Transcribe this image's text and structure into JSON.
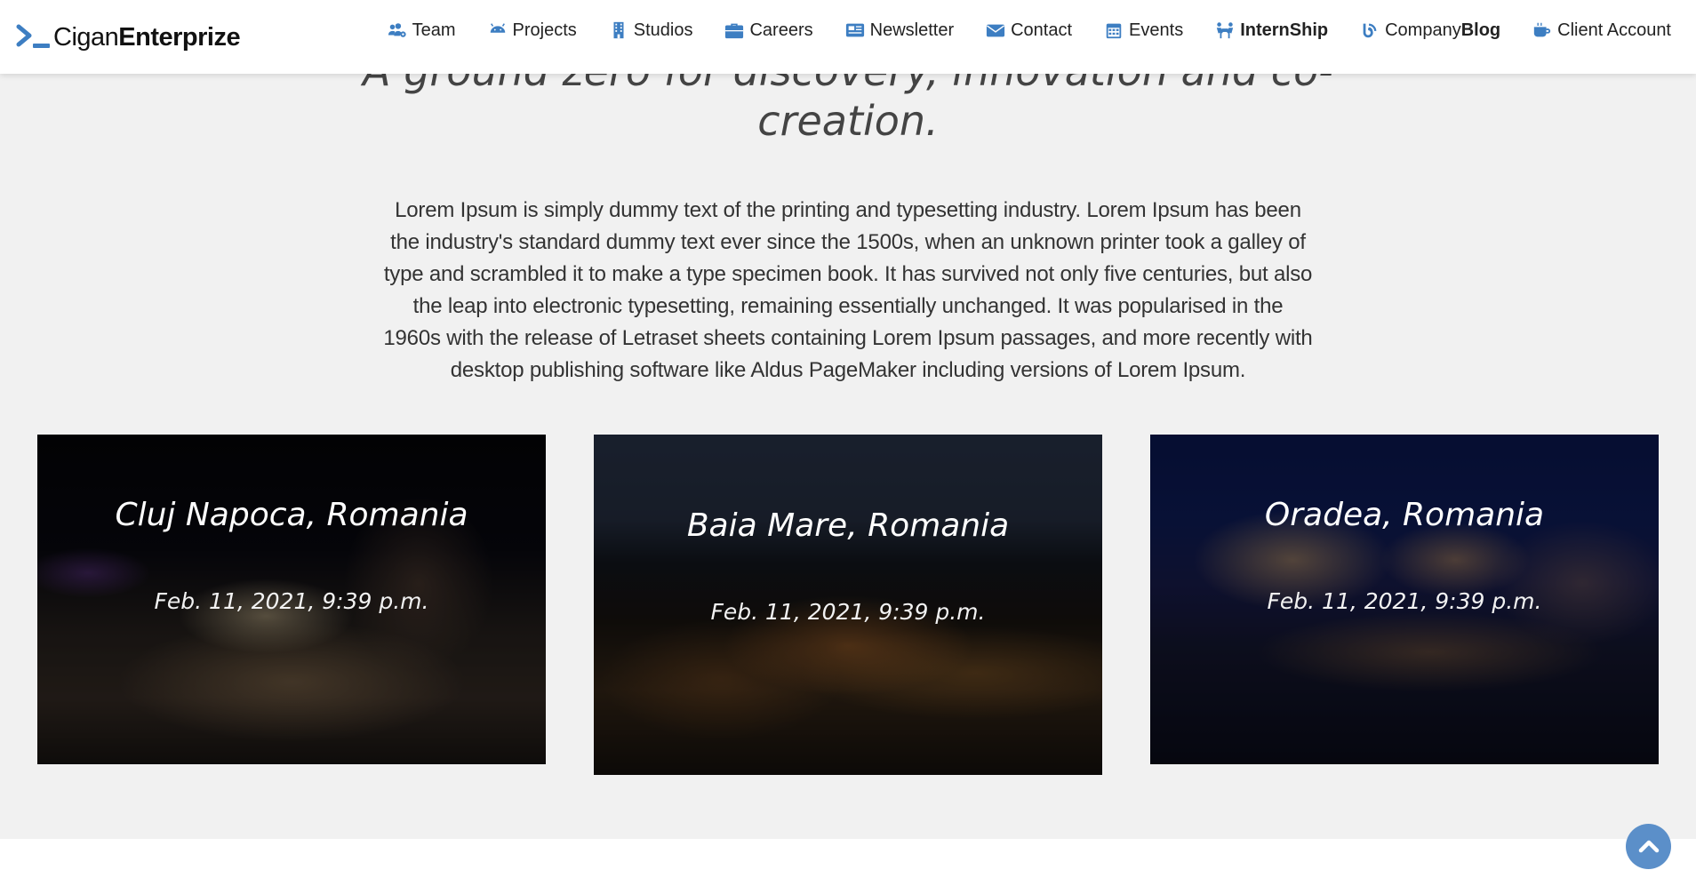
{
  "brand": {
    "name_light": "Cigan",
    "name_bold": "Enterprize"
  },
  "nav": {
    "items": [
      {
        "label": "Team",
        "icon": "users-cog-icon"
      },
      {
        "label": "Projects",
        "icon": "android-icon"
      },
      {
        "label": "Studios",
        "icon": "building-icon"
      },
      {
        "label": "Careers",
        "icon": "briefcase-icon"
      },
      {
        "label": "Newsletter",
        "icon": "newspaper-icon"
      },
      {
        "label": "Contact",
        "icon": "envelope-icon"
      },
      {
        "label": "Events",
        "icon": "calendar-icon"
      },
      {
        "label": "InternShip",
        "icon": "people-carry-icon"
      },
      {
        "label_plain": "Company",
        "label_bold": "Blog",
        "icon": "blog-icon"
      },
      {
        "label": "Client Account",
        "icon": "coffee-icon"
      }
    ]
  },
  "hero": {
    "headline": "A ground zero for discovery, innovation and co-creation.",
    "body": "Lorem Ipsum is simply dummy text of the printing and typesetting industry. Lorem Ipsum has been the industry's standard dummy text ever since the 1500s, when an unknown printer took a galley of type and scrambled it to make a type specimen book. It has survived not only five centuries, but also the leap into electronic typesetting, remaining essentially unchanged. It was popularised in the 1960s with the release of Letraset sheets containing Lorem Ipsum passages, and more recently with desktop publishing software like Aldus PageMaker including versions of Lorem Ipsum."
  },
  "cards": [
    {
      "title": "Cluj Napoca, Romania",
      "date": "Feb. 11, 2021, 9:39 p.m."
    },
    {
      "title": "Baia Mare, Romania",
      "date": "Feb. 11, 2021, 9:39 p.m."
    },
    {
      "title": "Oradea, Romania",
      "date": "Feb. 11, 2021, 9:39 p.m."
    }
  ],
  "colors": {
    "accent": "#3d7ec2",
    "section_bg": "#f1f1f1",
    "scroll_button": "#5b8fc9"
  },
  "scroll_top": {
    "icon": "chevron-up-icon"
  }
}
